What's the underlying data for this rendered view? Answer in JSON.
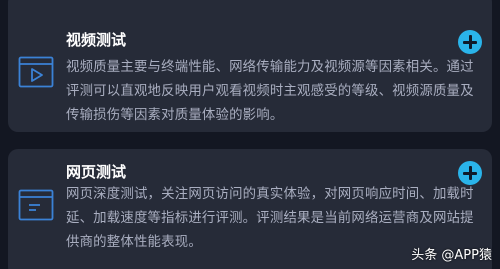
{
  "cards": [
    {
      "title": "视频测试",
      "description": "视频质量主要与终端性能、网络传输能力及视频源等因素相关。通过评测可以直观地反映用户观看视频时主观感受的等级、视频源质量及传输损伤等因素对质量体验的影响。",
      "icon": "video-play-icon"
    },
    {
      "title": "网页测试",
      "description": "网页深度测试，关注网页访问的真实体验，对网页响应时间、加载时延、加载速度等指标进行评测。评测结果是当前网络运营商及网站提供商的整体性能表现。",
      "icon": "webpage-icon"
    }
  ],
  "watermark": "头条 @APP猿",
  "colors": {
    "background": "#131722",
    "card": "#262b38",
    "accent": "#2ab4ea",
    "icon": "#3b82d6",
    "title": "#ffffff",
    "text": "#a9aec0"
  }
}
